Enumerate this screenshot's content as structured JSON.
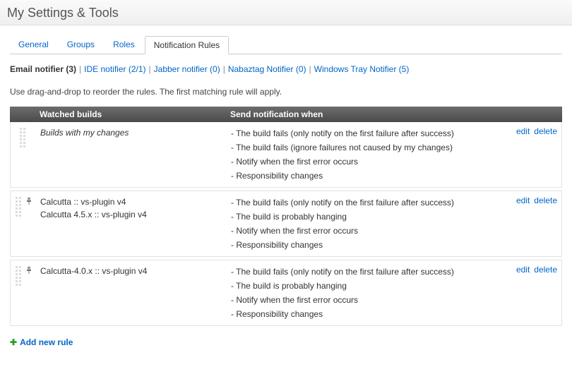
{
  "page_title": "My Settings & Tools",
  "tabs": [
    {
      "label": "General",
      "active": false
    },
    {
      "label": "Groups",
      "active": false
    },
    {
      "label": "Roles",
      "active": false
    },
    {
      "label": "Notification Rules",
      "active": true
    }
  ],
  "notifiers": [
    {
      "label": "Email notifier (3)",
      "selected": true
    },
    {
      "label": "IDE notifier (2/1)",
      "selected": false
    },
    {
      "label": "Jabber notifier (0)",
      "selected": false
    },
    {
      "label": "Nabaztag Notifier (0)",
      "selected": false
    },
    {
      "label": "Windows Tray Notifier (5)",
      "selected": false
    }
  ],
  "hint": "Use drag-and-drop to reorder the rules. The first matching rule will apply.",
  "table": {
    "col_builds": "Watched builds",
    "col_cond": "Send notification when"
  },
  "actions": {
    "edit": "edit",
    "delete": "delete"
  },
  "rules": [
    {
      "has_pin": false,
      "builds_italic": true,
      "builds": [
        "Builds with my changes"
      ],
      "conditions": [
        "- The build fails (only notify on the first failure after success)",
        "- The build fails (ignore failures not caused by my changes)",
        "- Notify when the first error occurs",
        "- Responsibility changes"
      ]
    },
    {
      "has_pin": true,
      "builds_italic": false,
      "builds": [
        "Calcutta :: vs-plugin v4",
        "Calcutta 4.5.x :: vs-plugin v4"
      ],
      "conditions": [
        "- The build fails (only notify on the first failure after success)",
        "- The build is probably hanging",
        "- Notify when the first error occurs",
        "- Responsibility changes"
      ]
    },
    {
      "has_pin": true,
      "builds_italic": false,
      "builds": [
        "Calcutta-4.0.x :: vs-plugin v4"
      ],
      "conditions": [
        "- The build fails (only notify on the first failure after success)",
        "- The build is probably hanging",
        "- Notify when the first error occurs",
        "- Responsibility changes"
      ]
    }
  ],
  "add_rule_label": "Add new rule"
}
